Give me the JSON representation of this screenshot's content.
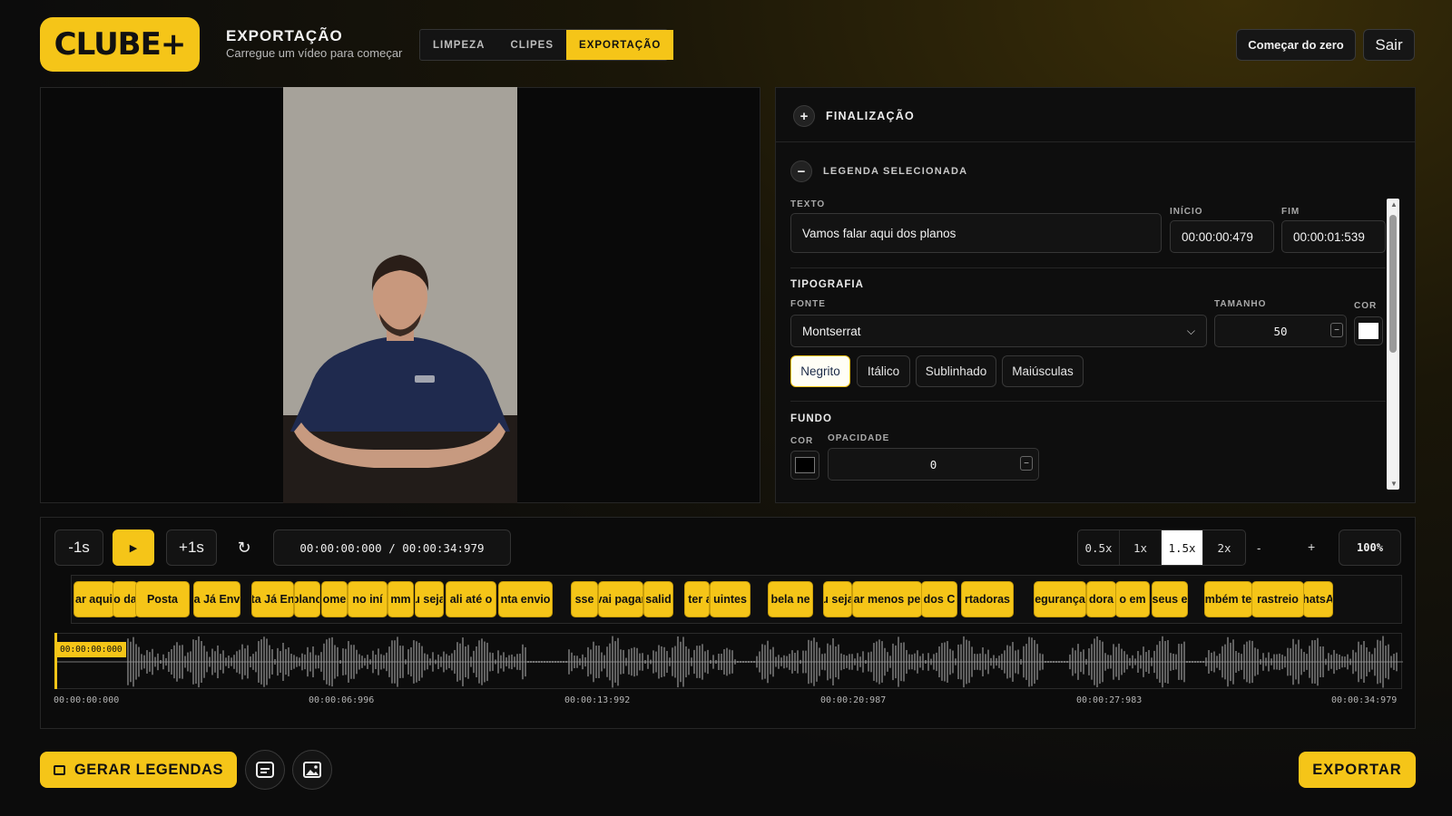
{
  "header": {
    "logo": "CLUBE+",
    "title": "EXPORTAÇÃO",
    "subtitle": "Carregue um vídeo para começar",
    "tabs": [
      {
        "label": "LIMPEZA",
        "active": false
      },
      {
        "label": "CLIPES",
        "active": false
      },
      {
        "label": "EXPORTAÇÃO",
        "active": true
      }
    ],
    "restart_label": "Começar do zero",
    "logout_label": "Sair"
  },
  "panel": {
    "finalizacao_title": "FINALIZAÇÃO",
    "legenda_title": "LEGENDA SELECIONADA",
    "texto_label": "TEXTO",
    "texto_value": "Vamos falar aqui dos planos",
    "inicio_label": "INÍCIO",
    "inicio_value": "00:00:00:479",
    "fim_label": "FIM",
    "fim_value": "00:00:01:539",
    "tipografia_title": "TIPOGRAFIA",
    "fonte_label": "FONTE",
    "fonte_value": "Montserrat",
    "tamanho_label": "TAMANHO",
    "tamanho_value": "50",
    "cor_label": "COR",
    "text_color": "#ffffff",
    "styles": [
      {
        "label": "Negrito",
        "active": true
      },
      {
        "label": "Itálico",
        "active": false
      },
      {
        "label": "Sublinhado",
        "active": false
      },
      {
        "label": "Maiúsculas",
        "active": false
      }
    ],
    "fundo_title": "FUNDO",
    "fundo_cor_label": "COR",
    "fundo_color": "#000000",
    "opacidade_label": "OPACIDADE",
    "opacidade_value": "0"
  },
  "player": {
    "back_label": "-1s",
    "fwd_label": "+1s",
    "time_display": "00:00:00:000 / 00:00:34:979",
    "speeds": [
      {
        "label": "0.5x",
        "active": false
      },
      {
        "label": "1x",
        "active": false
      },
      {
        "label": "1.5x",
        "active": true
      },
      {
        "label": "2x",
        "active": false
      }
    ],
    "zoom_out_label": "-",
    "zoom_in_label": "+",
    "zoom_value": "100%"
  },
  "clips": [
    "ar aqui",
    "o da",
    "Posta",
    "a Já Env",
    "ta Já En",
    "plano",
    "ome",
    "no iní",
    "mm",
    "u seja",
    "ali até o",
    "nta envio",
    "sse",
    "vai pagar",
    "salid",
    "i ter a",
    "uintes",
    "bela ne",
    "u seja",
    "ar menos pe",
    "dos C",
    "rtadoras",
    "egurança",
    "dora",
    "o em",
    "seus e",
    "mbém te",
    "rastreio",
    "hatsA"
  ],
  "waveform": {
    "playhead_label": "00:00:00:000",
    "ticks": [
      "00:00:00:000",
      "00:00:06:996",
      "00:00:13:992",
      "00:00:20:987",
      "00:00:27:983",
      "00:00:34:979"
    ]
  },
  "footer": {
    "generate_label": "GERAR LEGENDAS",
    "export_label": "EXPORTAR"
  },
  "colors": {
    "accent": "#f5c518"
  }
}
